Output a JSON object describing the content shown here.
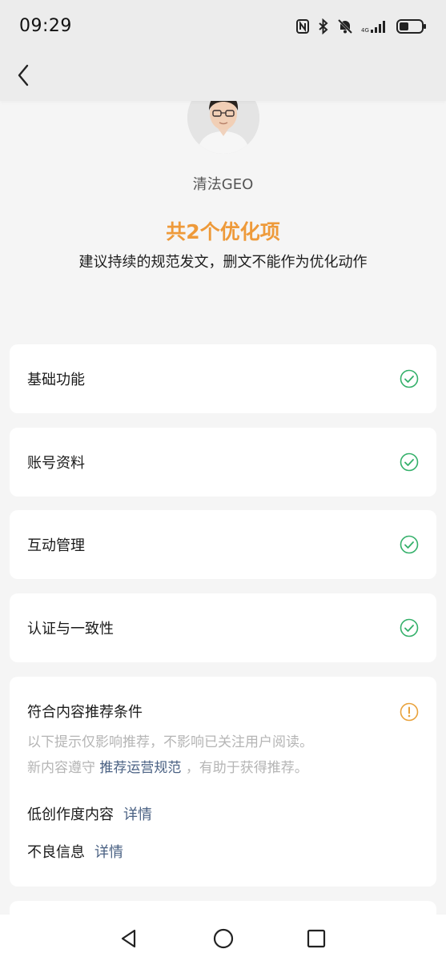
{
  "status_bar": {
    "time": "09:29",
    "icons": [
      "nfc-icon",
      "bluetooth-icon",
      "mute-icon",
      "signal-icon",
      "battery-icon"
    ]
  },
  "nav": {
    "back_icon": "chevron-left-icon"
  },
  "profile": {
    "name": "清法GEO",
    "summary_title": "共2个优化项",
    "summary_desc": "建议持续的规范发文，删文不能作为优化动作"
  },
  "checks": [
    {
      "label": "基础功能",
      "status": "ok"
    },
    {
      "label": "账号资料",
      "status": "ok"
    },
    {
      "label": "互动管理",
      "status": "ok"
    },
    {
      "label": "认证与一致性",
      "status": "ok"
    }
  ],
  "recommend": {
    "title": "符合内容推荐条件",
    "status": "warning",
    "note_line1": "以下提示仅影响推荐，不影响已关注用户阅读。",
    "note_prefix": "新内容遵守",
    "note_link": "推荐运营规范",
    "note_suffix": "，有助于获得推荐。",
    "issues": [
      {
        "label": "低创作度内容",
        "link": "详情"
      },
      {
        "label": "不良信息",
        "link": "详情"
      }
    ]
  },
  "colors": {
    "accent_orange": "#ee9a3a",
    "ok_green": "#34b06a",
    "warn_orange": "#e9a23b",
    "link_blue": "#4a6183"
  }
}
